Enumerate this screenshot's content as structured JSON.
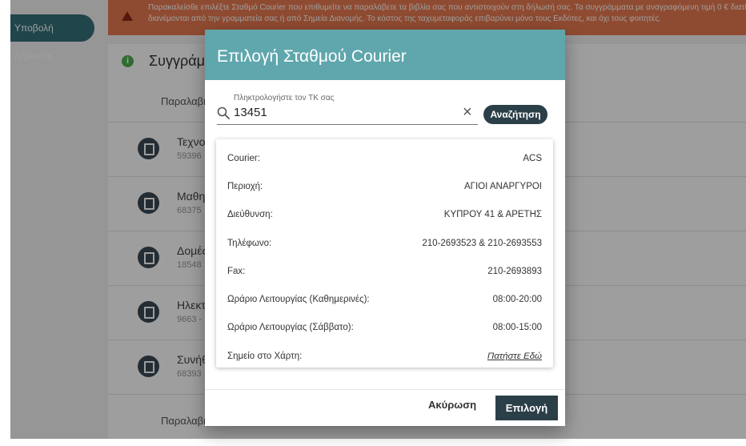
{
  "background": {
    "alert_lines": [
      "Παρακαλείσθε επιλέξτε Σταθμό Courier που επιθυμείτε να παραλάβετε τα βιβλία σας που αντιστοιχούν στη δήλωσή σας. Τα συγγράμματα με αναγραφόμενη τιμή 0 € διατίθενται",
      "διανέμονται από την γραμματεία σας ή από Σημεία Διανομής. Το κόστος της ταχυμεταφοράς επιβαρύνει μόνο τους Εκδότες, και όχι τους φοιτητές."
    ],
    "submit_label": "Υποβολή Δήλωσης",
    "section_title": "Συγγράμματα",
    "receive_label": "Παραλαβή",
    "books": [
      {
        "title": "Τεχνολογία",
        "code": "59396"
      },
      {
        "title": "Μαθηματικά",
        "code": "68375"
      },
      {
        "title": "Δομές",
        "code": "18548"
      },
      {
        "title": "Ηλεκτρονικά",
        "code": "9663 -"
      },
      {
        "title": "Συνήθεις",
        "code": "68393"
      }
    ]
  },
  "dialog": {
    "title": "Επιλογή Σταθμού Courier",
    "search": {
      "label": "Πληκτρολογήστε τον ΤΚ σας",
      "value": "13451",
      "button": "Αναζήτηση"
    },
    "info": [
      {
        "label": "Courier:",
        "value": "ACS"
      },
      {
        "label": "Περιοχή:",
        "value": "ΑΓΙΟΙ ΑΝΑΡΓΥΡΟΙ"
      },
      {
        "label": "Διεύθυνση:",
        "value": "ΚΥΠΡΟΥ 41 & ΑΡΕΤΗΣ"
      },
      {
        "label": "Τηλέφωνο:",
        "value": "210-2693523 & 210-2693553"
      },
      {
        "label": "Fax:",
        "value": "210-2693893"
      },
      {
        "label": "Ωράριο Λειτουργίας (Καθημερινές):",
        "value": "08:00-20:00"
      },
      {
        "label": "Ωράριο Λειτουργίας (Σάββατο):",
        "value": "08:00-15:00"
      },
      {
        "label": "Σημείο στο Χάρτη:",
        "value": "Πατήστε Εδώ"
      }
    ],
    "cancel_label": "Ακύρωση",
    "select_label": "Επιλογή"
  }
}
